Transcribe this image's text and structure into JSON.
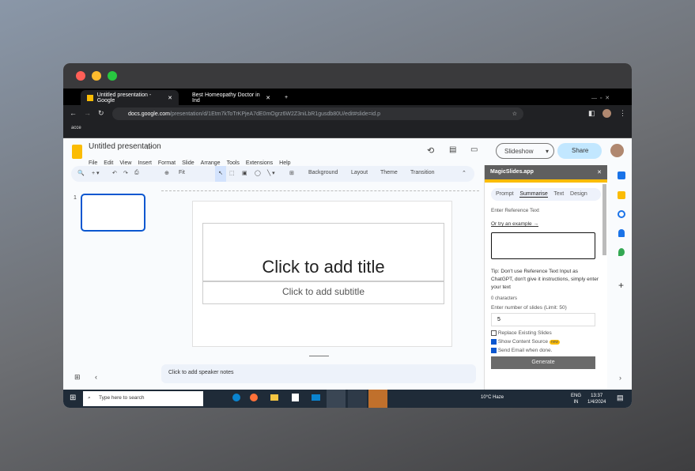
{
  "browser": {
    "tabs": [
      {
        "label": "Untitled presentation - Google"
      },
      {
        "label": "Best Homeopathy Doctor in Ind"
      }
    ],
    "url_host": "docs.google.com",
    "url_path": "/presentation/d/1Etm7kToTrKPjeA7dE0mOgrz6W2Z3niLbR1gusdb80U/edit#slide=id.p",
    "bookmark": "acce"
  },
  "doc": {
    "title": "Untitled presentation",
    "menu": [
      "File",
      "Edit",
      "View",
      "Insert",
      "Format",
      "Slide",
      "Arrange",
      "Tools",
      "Extensions",
      "Help"
    ],
    "slideshow": "Slideshow",
    "share": "Share"
  },
  "toolbar": {
    "zoom": "Fit",
    "background": "Background",
    "layout": "Layout",
    "theme": "Theme",
    "transition": "Transition"
  },
  "slide": {
    "number": "1",
    "title_placeholder": "Click to add title",
    "subtitle_placeholder": "Click to add subtitle",
    "notes_placeholder": "Click to add speaker notes"
  },
  "panel": {
    "title": "MagicSlides.app",
    "tabs": [
      "Prompt",
      "Summarise",
      "Text",
      "Design"
    ],
    "ref_label": "Enter Reference Text",
    "example_link": "Or try an example →",
    "tip": "Tip: Don't use Reference Text Input as ChatGPT, don't give it instructions, simply enter your text",
    "char_count": "0 characters",
    "slides_label": "Enter number of slides (Limit: 50)",
    "slides_value": "5",
    "replace": "Replace Existing Slides",
    "show_source": "Show Content Source",
    "new_badge": "new",
    "send_email": "Send Email when done.",
    "generate": "Generate"
  },
  "taskbar": {
    "search": "Type here to search",
    "weather": "10°C  Haze",
    "lang1": "ENG",
    "lang2": "IN",
    "time": "13:37",
    "date": "1/4/2024"
  },
  "colors": {
    "accent": "#0b57d0",
    "share_bg": "#c2e7ff",
    "panel_bar": "#fbbc04"
  }
}
